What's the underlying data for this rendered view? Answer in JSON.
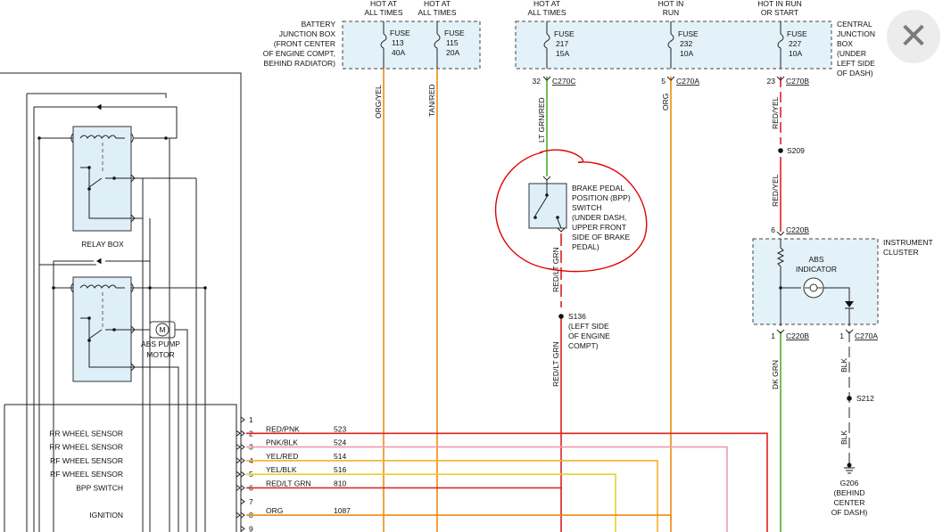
{
  "fuse_sources": {
    "battery_box": [
      "BATTERY",
      "JUNCTION BOX",
      "(FRONT CENTER",
      "OF ENGINE COMPT,",
      "BEHIND RADIATOR)"
    ],
    "central_box": [
      "CENTRAL",
      "JUNCTION",
      "BOX",
      "(UNDER",
      "LEFT SIDE",
      "OF DASH)"
    ],
    "hot_labels": [
      [
        "HOT AT",
        "ALL TIMES"
      ],
      [
        "HOT AT",
        "ALL TIMES"
      ],
      [
        "HOT AT",
        "ALL TIMES"
      ],
      [
        "HOT IN",
        "RUN"
      ],
      [
        "HOT IN RUN",
        "OR START"
      ]
    ],
    "fuses": [
      {
        "word": "FUSE",
        "num": "113",
        "amp": "40A"
      },
      {
        "word": "FUSE",
        "num": "115",
        "amp": "20A"
      },
      {
        "word": "FUSE",
        "num": "217",
        "amp": "15A"
      },
      {
        "word": "FUSE",
        "num": "232",
        "amp": "10A"
      },
      {
        "word": "FUSE",
        "num": "227",
        "amp": "10A"
      }
    ]
  },
  "connectors": {
    "c270c_pin": "32",
    "c270c": "C270C",
    "c270a_pin": "5",
    "c270a": "C270A",
    "c270b_pin": "23",
    "c270b": "C270B",
    "c220b_top_pin": "6",
    "c220b_top": "C220B",
    "c220b_bot_pin": "1",
    "c220b_bot": "C220B",
    "c270a_bot_pin": "1",
    "c270a_bot": "C270A"
  },
  "wire_labels": {
    "org_yel": "ORG/YEL",
    "tan_red": "TAN/RED",
    "lt_grn_red": "LT GRN/RED",
    "org": "ORG",
    "red_yel_1": "RED/YEL",
    "red_yel_2": "RED/YEL",
    "red_lt_grn_1": "RED/LT GRN",
    "red_lt_grn_2": "RED/LT GRN",
    "dk_grn": "DK GRN",
    "blk_1": "BLK",
    "blk_2": "BLK"
  },
  "splices": {
    "s209": "S209",
    "s136": [
      "S136",
      "(LEFT SIDE",
      "OF ENGINE",
      "COMPT)"
    ],
    "s212": "S212",
    "g206": [
      "G206",
      "(BEHIND",
      "CENTER",
      "OF DASH)"
    ]
  },
  "bpp_switch": [
    "BRAKE PEDAL",
    "POSITION (BPP)",
    "SWITCH",
    "(UNDER DASH,",
    "UPPER FRONT",
    "SIDE OF BRAKE",
    "PEDAL)"
  ],
  "instrument_cluster": {
    "label": [
      "INSTRUMENT",
      "CLUSTER"
    ],
    "indicator": [
      "ABS",
      "INDICATOR"
    ]
  },
  "relay_box_label": "RELAY BOX",
  "pump_motor": {
    "symbol": "M",
    "label": [
      "ABS PUMP",
      "MOTOR"
    ]
  },
  "module_inputs": [
    {
      "pin": "1",
      "name": "",
      "color": "",
      "circuit": "",
      "hex": "#444444"
    },
    {
      "pin": "2",
      "name": "RR WHEEL SENSOR",
      "color": "RED/PNK",
      "circuit": "523",
      "hex": "#e02020"
    },
    {
      "pin": "3",
      "name": "RR WHEEL SENSOR",
      "color": "PNK/BLK",
      "circuit": "524",
      "hex": "#e8a0a8"
    },
    {
      "pin": "4",
      "name": "RF WHEEL SENSOR",
      "color": "YEL/RED",
      "circuit": "514",
      "hex": "#f0b030"
    },
    {
      "pin": "5",
      "name": "RF WHEEL SENSOR",
      "color": "YEL/BLK",
      "circuit": "516",
      "hex": "#e8d030"
    },
    {
      "pin": "6",
      "name": "BPP SWITCH",
      "color": "RED/LT GRN",
      "circuit": "810",
      "hex": "#d82020"
    },
    {
      "pin": "7",
      "name": "",
      "color": "",
      "circuit": "",
      "hex": "#444444"
    },
    {
      "pin": "8",
      "name": "IGNITION",
      "color": "ORG",
      "circuit": "1087",
      "hex": "#f08a10"
    },
    {
      "pin": "9",
      "name": "",
      "color": "",
      "circuit": "",
      "hex": "#444444"
    }
  ],
  "colors": {
    "orange": "#f08a10",
    "red": "#e02020",
    "green": "#49b02d",
    "gray": "#777777",
    "annotation": "#e00000"
  },
  "close_icon": "close-icon"
}
